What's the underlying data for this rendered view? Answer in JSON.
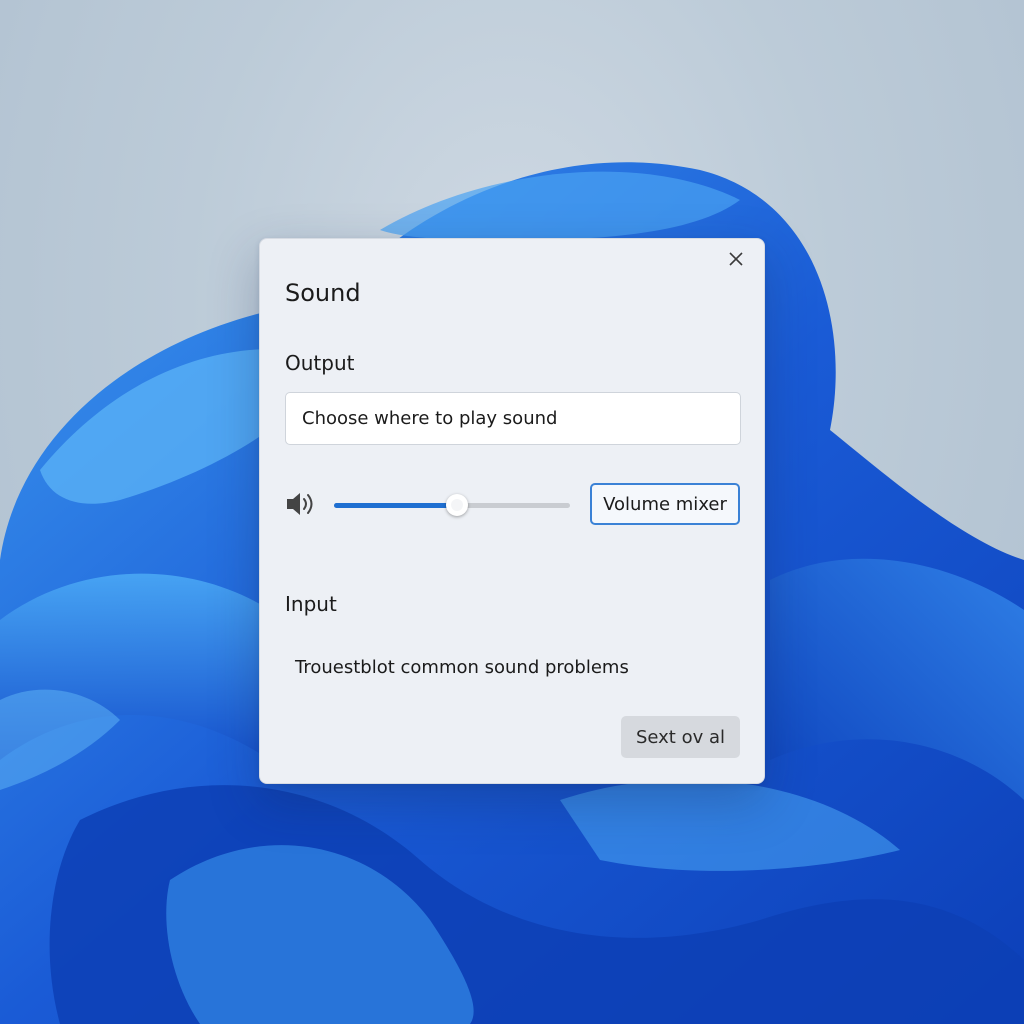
{
  "dialog": {
    "title": "Sound",
    "close_icon": "close-icon"
  },
  "output": {
    "label": "Output",
    "device_select": "Choose where to play sound",
    "speaker_icon": "speaker-icon",
    "volume_level": 0.52,
    "mixer_button": "Volume mixer"
  },
  "input": {
    "label": "Input",
    "troubleshoot_link": "Trouestblot common sound problems",
    "bottom_button": "Sext ov al"
  },
  "colors": {
    "accent": "#1f6fd1",
    "dialog_bg": "#edf0f5",
    "wallpaper_blue": "#1a5bd6"
  }
}
